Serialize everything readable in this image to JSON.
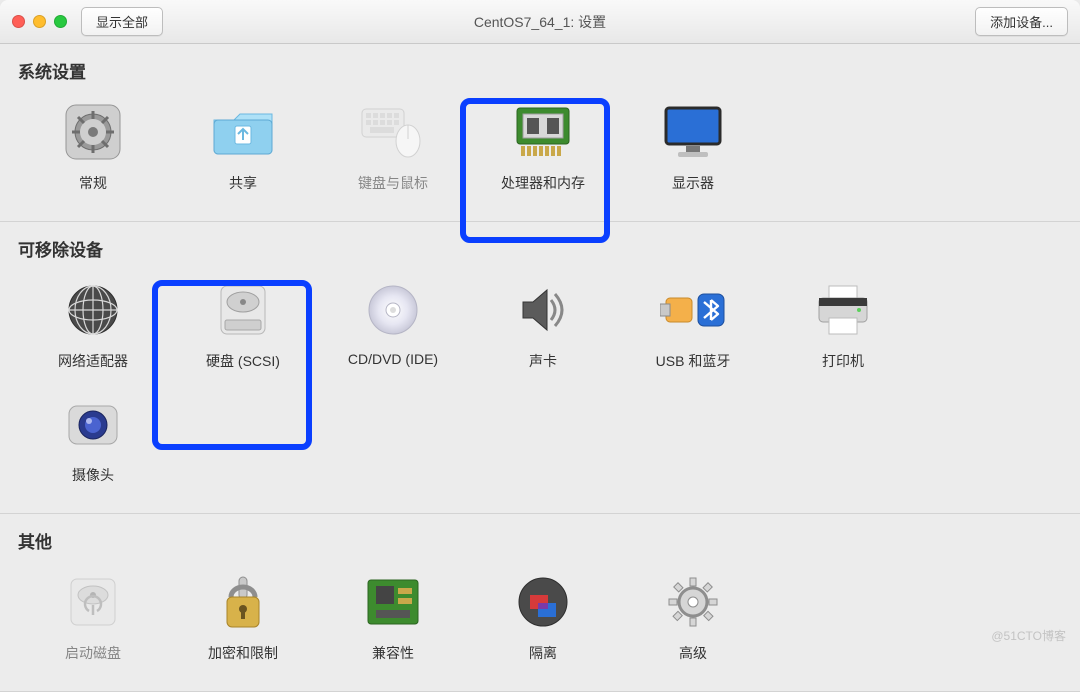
{
  "window": {
    "title": "CentOS7_64_1: 设置",
    "show_all_label": "显示全部",
    "add_device_label": "添加设备..."
  },
  "sections": {
    "system": {
      "title": "系统设置",
      "items": [
        {
          "id": "general",
          "label": "常规"
        },
        {
          "id": "sharing",
          "label": "共享"
        },
        {
          "id": "kbmouse",
          "label": "键盘与鼠标"
        },
        {
          "id": "cpuMem",
          "label": "处理器和内存"
        },
        {
          "id": "display",
          "label": "显示器"
        }
      ]
    },
    "removable": {
      "title": "可移除设备",
      "items": [
        {
          "id": "network",
          "label": "网络适配器"
        },
        {
          "id": "disk",
          "label": "硬盘 (SCSI)"
        },
        {
          "id": "cddvd",
          "label": "CD/DVD (IDE)"
        },
        {
          "id": "sound",
          "label": "声卡"
        },
        {
          "id": "usbbt",
          "label": "USB 和蓝牙"
        },
        {
          "id": "printer",
          "label": "打印机"
        },
        {
          "id": "camera",
          "label": "摄像头"
        }
      ]
    },
    "other": {
      "title": "其他",
      "items": [
        {
          "id": "startup",
          "label": "启动磁盘"
        },
        {
          "id": "encrypt",
          "label": "加密和限制"
        },
        {
          "id": "compat",
          "label": "兼容性"
        },
        {
          "id": "isolate",
          "label": "隔离"
        },
        {
          "id": "advanced",
          "label": "高级"
        }
      ]
    }
  },
  "watermark": "@51CTO博客"
}
